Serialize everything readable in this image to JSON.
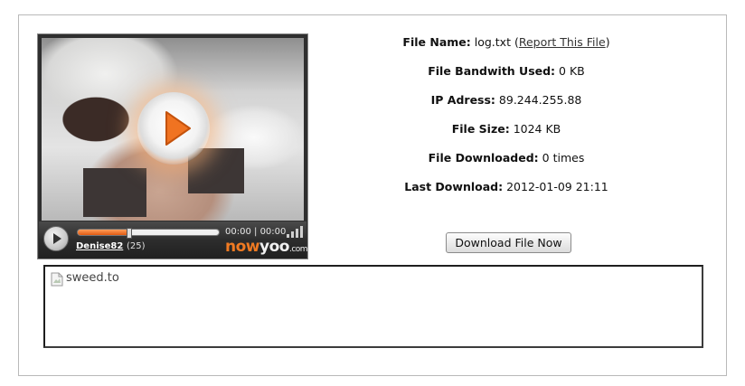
{
  "player": {
    "uploader": "Denise82",
    "count": "(25)",
    "time_current": "00:00",
    "time_total": "00:00",
    "brand_now": "now",
    "brand_yoo": "yoo",
    "brand_com": ".com",
    "progress_fraction": 0.36
  },
  "file_info": {
    "file_name_label": "File Name:",
    "file_name_value": "log.txt",
    "report_open": " (",
    "report_link": "Report This File",
    "report_close": ")",
    "bandwidth_label": "File Bandwith Used:",
    "bandwidth_value": "0 KB",
    "ip_label": "IP Adress:",
    "ip_value": "89.244.255.88",
    "size_label": "File Size:",
    "size_value": "1024 KB",
    "downloaded_label": "File Downloaded:",
    "downloaded_value": "0 times",
    "last_label": "Last Download:",
    "last_value": "2012-01-09 21:11"
  },
  "download_button": "Download File Now",
  "frame": {
    "image_alt": "sweed.to"
  }
}
